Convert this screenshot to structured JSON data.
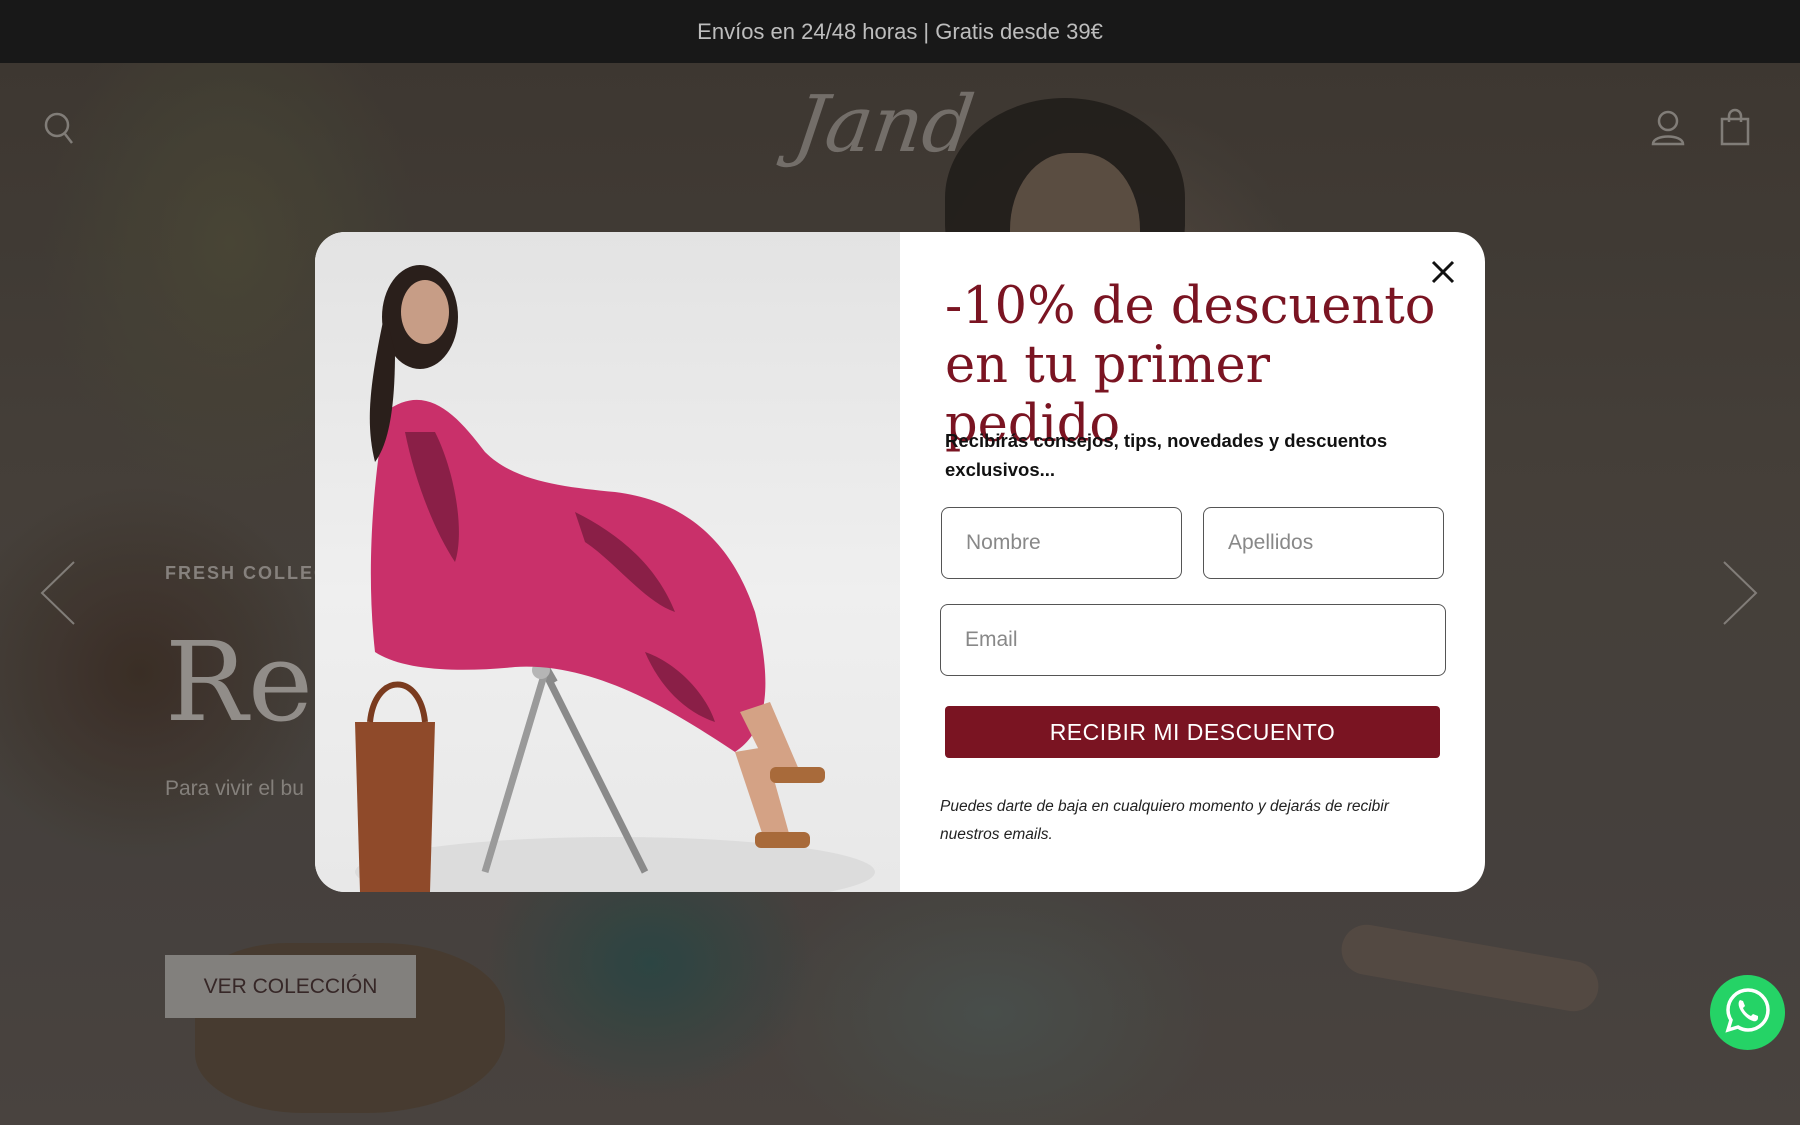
{
  "announcement": {
    "text": "Envíos en 24/48 horas | Gratis desde 39€"
  },
  "header": {
    "logo_text": "Jand",
    "icons": [
      "search-icon",
      "account-icon",
      "bag-icon"
    ]
  },
  "hero": {
    "eyebrow": "FRESH COLLEC",
    "title": "Reb",
    "subtitle": "Para vivir el bu",
    "button_label": "VER COLECCIÓN"
  },
  "modal": {
    "title": "-10% de descuento en tu primer pedido",
    "subtitle": "Recibirás consejos, tips, novedades y descuentos exclusivos...",
    "fields": {
      "first_name_placeholder": "Nombre",
      "last_name_placeholder": "Apellidos",
      "email_placeholder": "Email"
    },
    "submit_label": "RECIBIR MI DESCUENTO",
    "legal": "Puedes darte de baja en cualquiero momento y dejarás de recibir nuestros emails."
  },
  "colors": {
    "brand_burgundy": "#7a1422",
    "whatsapp_green": "#25d366",
    "announcement_bg": "#1a1a1a"
  }
}
